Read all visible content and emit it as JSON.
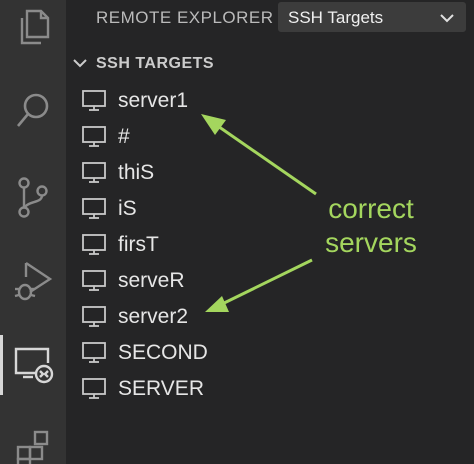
{
  "header": {
    "title": "REMOTE EXPLORER",
    "select_value": "SSH Targets"
  },
  "section": {
    "title": "SSH TARGETS"
  },
  "items": [
    {
      "label": "server1"
    },
    {
      "label": "#"
    },
    {
      "label": "thiS"
    },
    {
      "label": "iS"
    },
    {
      "label": "firsT"
    },
    {
      "label": "serveR"
    },
    {
      "label": "server2"
    },
    {
      "label": "SECOND"
    },
    {
      "label": "SERVER"
    }
  ],
  "annotation": {
    "line1": "correct",
    "line2": "servers",
    "color": "#a4d65e"
  },
  "activity_bar": {
    "icons": [
      "files-icon",
      "search-icon",
      "source-control-icon",
      "run-debug-icon",
      "remote-explorer-icon",
      "extensions-icon"
    ]
  }
}
